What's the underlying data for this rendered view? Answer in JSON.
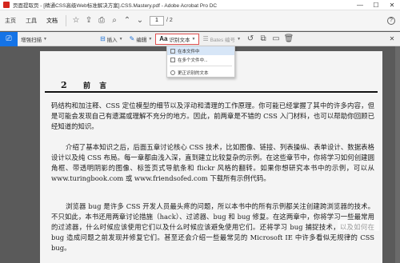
{
  "window": {
    "title": "页面提取页 - [精通CSS高级Web标准解决方案].CSS.Mastery.pdf - Adobe Acrobat Pro DC",
    "minimize": "—",
    "maximize": "☐",
    "close": "✕"
  },
  "menubar": {
    "tabs": [
      "主页",
      "工具",
      "文档"
    ],
    "page_current": "1",
    "page_total": "/ 2",
    "help": "?"
  },
  "toolbar": {
    "scan_label": "增强扫描",
    "insert_label": "插入",
    "edit_label": "编辑",
    "recognize_label": "识别文本",
    "bates_label": "Bates 编号"
  },
  "recognize_menu": {
    "items": [
      "在本文件中",
      "在多个文件中...",
      "更正识别的文本"
    ]
  },
  "document": {
    "chapter_number": "2",
    "chapter_title": "前 言",
    "paragraphs": [
      "码结构和加注释、CSS 定位模型的细节以及浮动和清理的工作原理。你可能已经掌握了其中的许多内容，但是可能会发现自己有遗漏或理解不充分的地方。因此，前两章是不错的 CSS 入门材料，也可以帮助你回顾已经知道的知识。",
      "介绍了基本知识之后，后面五章讨论核心 CSS 技术，比如图像、链接、列表操纵、表单设计、数据表格设计以及纯 CSS 布局。每一章都由浅入深，直到建立比较复杂的示例。在这些章节中，你将学习如何创建圆角框、带透明阴影的图像、标签页式导航条和 flickr 风格的翻转。如果你想研究本书中的示例，可以从 www.turingbook.com 或 www.friendsofed.com 下载所有示例代码。",
      "浏览器 bug 是许多 CSS 开发人员最头疼的问题，所以本书中的所有示例都关注创建跨浏览器的技术。不只如此，本书还用两章讨论措施（hack）、过滤器、bug 和 bug 修复。在这两章中，你将学习一些最常用的过滤器，什么时候应该使用它们以及什么时候应该避免使用它们。还将学习 bug 捕捉技术，以及如何在 bug 造成问题之前发现并修复它们。甚至还会介绍一些最常见的 Microsoft IE 中许多看似无规律的 CSS bug。"
    ]
  },
  "colors": {
    "accent": "#1473e6",
    "pdf_red": "#d4261c",
    "background": "#5a5a5a"
  }
}
